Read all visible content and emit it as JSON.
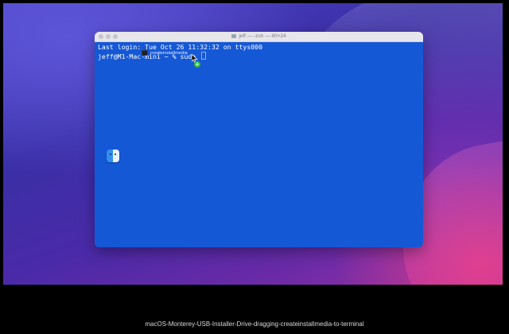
{
  "window": {
    "title": "jeff — -zsh — 80×24"
  },
  "terminal": {
    "lines": [
      "Last login: Tue Oct 26 11:32:32 on ttys000",
      "jeff@M1-Mac-mini ~ % sudo "
    ]
  },
  "drag": {
    "item_label": "createinstallmedia",
    "item_icon": "terminal-executable-icon",
    "copy_badge": "+"
  },
  "desktop": {
    "icon": "finder-icon"
  },
  "caption": {
    "text": "macOS-Monterey-USB-Installer-Drive-dragging-createinstallmedia-to-terminal"
  },
  "colors": {
    "terminal_background": "#1558d6",
    "copy_badge": "#2bbf3a"
  }
}
